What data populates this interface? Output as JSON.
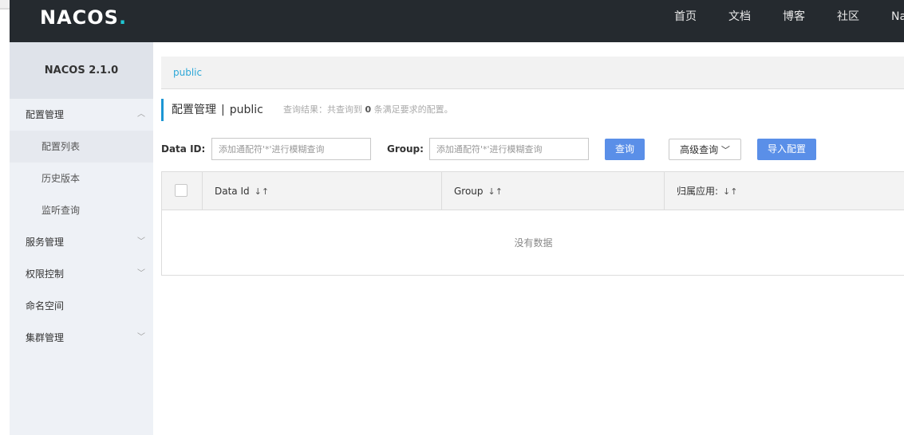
{
  "header": {
    "logo_text": "NACOS",
    "logo_dot": ".",
    "nav": [
      "首页",
      "文档",
      "博客",
      "社区",
      "Na"
    ]
  },
  "sidebar": {
    "title": "NACOS 2.1.0",
    "items": [
      {
        "label": "配置管理",
        "chevron": "up"
      },
      {
        "label": "配置列表",
        "sub": true
      },
      {
        "label": "历史版本",
        "sub": true
      },
      {
        "label": "监听查询",
        "sub": true
      },
      {
        "label": "服务管理",
        "chevron": "down"
      },
      {
        "label": "权限控制",
        "chevron": "down"
      },
      {
        "label": "命名空间"
      },
      {
        "label": "集群管理",
        "chevron": "down"
      }
    ]
  },
  "main": {
    "breadcrumb": "public",
    "title": "配置管理",
    "title_sep": "|",
    "title_namespace": "public",
    "result_prefix": "查询结果：共查询到",
    "result_count": "0",
    "result_suffix": "条满足要求的配置。",
    "filters": {
      "data_id_label": "Data ID:",
      "data_id_placeholder": "添加通配符'*'进行模糊查询",
      "group_label": "Group:",
      "group_placeholder": "添加通配符'*'进行模糊查询",
      "query_button": "查询",
      "advanced_query": "高级查询",
      "import_button": "导入配置"
    },
    "table": {
      "columns": [
        "Data Id",
        "Group",
        "归属应用:"
      ],
      "empty_text": "没有数据"
    }
  }
}
